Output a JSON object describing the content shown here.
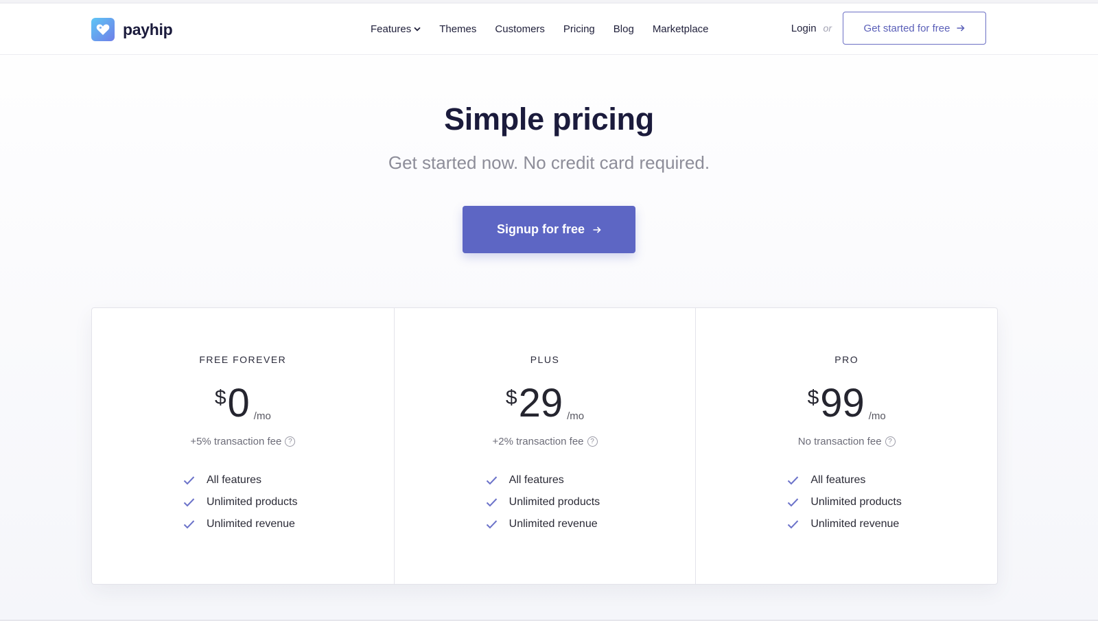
{
  "brand": {
    "name": "payhip"
  },
  "nav": {
    "items": [
      {
        "label": "Features",
        "has_dropdown": true
      },
      {
        "label": "Themes"
      },
      {
        "label": "Customers"
      },
      {
        "label": "Pricing"
      },
      {
        "label": "Blog"
      },
      {
        "label": "Marketplace"
      }
    ]
  },
  "header": {
    "login_label": "Login",
    "or_label": "or",
    "cta_label": "Get started for free"
  },
  "hero": {
    "title": "Simple pricing",
    "subtitle": "Get started now. No credit card required.",
    "signup_label": "Signup for free"
  },
  "plans": [
    {
      "name": "FREE FOREVER",
      "currency": "$",
      "amount": "0",
      "period": "/mo",
      "fee": "+5% transaction fee",
      "features": [
        "All features",
        "Unlimited products",
        "Unlimited revenue"
      ]
    },
    {
      "name": "PLUS",
      "currency": "$",
      "amount": "29",
      "period": "/mo",
      "fee": "+2% transaction fee",
      "features": [
        "All features",
        "Unlimited products",
        "Unlimited revenue"
      ]
    },
    {
      "name": "PRO",
      "currency": "$",
      "amount": "99",
      "period": "/mo",
      "fee": "No transaction fee",
      "features": [
        "All features",
        "Unlimited products",
        "Unlimited revenue"
      ]
    }
  ],
  "colors": {
    "accent": "#5d66c4",
    "heading": "#1b1b3c",
    "check": "#6b72c9"
  },
  "icons": {
    "logo": "heart-tag-icon",
    "dropdown": "chevron-down-icon",
    "arrow": "arrow-right-icon",
    "help": "question-circle-icon",
    "feature": "check-icon"
  }
}
